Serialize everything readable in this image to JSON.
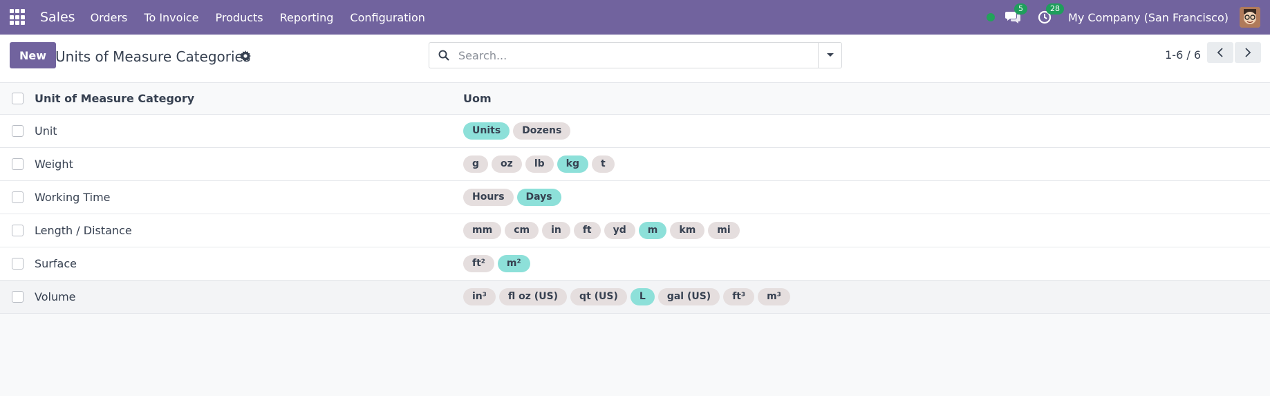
{
  "navbar": {
    "brand": "Sales",
    "menu": [
      "Orders",
      "To Invoice",
      "Products",
      "Reporting",
      "Configuration"
    ],
    "messages_count": "5",
    "activities_count": "28",
    "company": "My Company (San Francisco)"
  },
  "control": {
    "new_label": "New",
    "title": "Units of Measure Categories",
    "search_placeholder": "Search...",
    "pager": "1-6 / 6"
  },
  "table": {
    "headers": [
      "Unit of Measure Category",
      "Uom"
    ],
    "rows": [
      {
        "name": "Unit",
        "uoms": [
          {
            "label": "Units",
            "ref": true
          },
          {
            "label": "Dozens",
            "ref": false
          }
        ]
      },
      {
        "name": "Weight",
        "uoms": [
          {
            "label": "g",
            "ref": false
          },
          {
            "label": "oz",
            "ref": false
          },
          {
            "label": "lb",
            "ref": false
          },
          {
            "label": "kg",
            "ref": true
          },
          {
            "label": "t",
            "ref": false
          }
        ]
      },
      {
        "name": "Working Time",
        "uoms": [
          {
            "label": "Hours",
            "ref": false
          },
          {
            "label": "Days",
            "ref": true
          }
        ]
      },
      {
        "name": "Length / Distance",
        "uoms": [
          {
            "label": "mm",
            "ref": false
          },
          {
            "label": "cm",
            "ref": false
          },
          {
            "label": "in",
            "ref": false
          },
          {
            "label": "ft",
            "ref": false
          },
          {
            "label": "yd",
            "ref": false
          },
          {
            "label": "m",
            "ref": true
          },
          {
            "label": "km",
            "ref": false
          },
          {
            "label": "mi",
            "ref": false
          }
        ]
      },
      {
        "name": "Surface",
        "uoms": [
          {
            "label": "ft²",
            "ref": false
          },
          {
            "label": "m²",
            "ref": true
          }
        ]
      },
      {
        "name": "Volume",
        "uoms": [
          {
            "label": "in³",
            "ref": false
          },
          {
            "label": "fl oz (US)",
            "ref": false
          },
          {
            "label": "qt (US)",
            "ref": false
          },
          {
            "label": "L",
            "ref": true
          },
          {
            "label": "gal (US)",
            "ref": false
          },
          {
            "label": "ft³",
            "ref": false
          },
          {
            "label": "m³",
            "ref": false
          }
        ]
      }
    ]
  },
  "colors": {
    "navbar": "#71639e",
    "tag": "#e5dede",
    "tag_reference": "#8de0d9",
    "online": "#22a35a"
  }
}
